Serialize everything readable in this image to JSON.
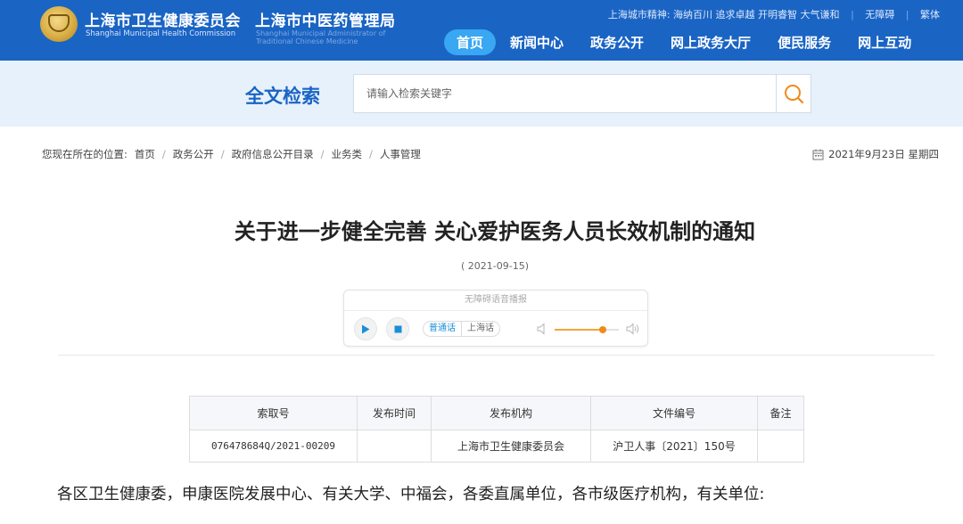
{
  "header": {
    "title_cn": "上海市卫生健康委员会",
    "title_en": "Shanghai Municipal Health Commission",
    "title2_cn": "上海市中医药管理局",
    "title2_en_line1": "Shanghai Municipal Administrator of",
    "title2_en_line2": "Traditional Chinese Medicine",
    "top_links": {
      "slogan": "上海城市精神: 海纳百川 追求卓越 开明睿智 大气谦和",
      "accessible": "无障碍",
      "traditional": "繁体"
    },
    "nav": [
      {
        "label": "首页",
        "active": true
      },
      {
        "label": "新闻中心",
        "active": false
      },
      {
        "label": "政务公开",
        "active": false
      },
      {
        "label": "网上政务大厅",
        "active": false
      },
      {
        "label": "便民服务",
        "active": false
      },
      {
        "label": "网上互动",
        "active": false
      }
    ],
    "bg_color": "#1a64c4",
    "active_nav_color": "#39a7f2"
  },
  "search": {
    "title": "全文检索",
    "placeholder": "请输入检索关键字",
    "button_icon": "search-icon",
    "icon_color": "#f08a1c"
  },
  "breadcrumb": {
    "prefix": "您现在所在的位置:",
    "items": [
      "首页",
      "政务公开",
      "政府信息公开目录",
      "业务类",
      "人事管理"
    ]
  },
  "date": {
    "text": "2021年9月23日 星期四",
    "icon": "calendar-icon"
  },
  "article": {
    "title": "关于进一步健全完善 关心爱护医务人员长效机制的通知",
    "date": "( 2021-09-15)",
    "first_paragraph": "各区卫生健康委，申康医院发展中心、有关大学、中福会，各委直属单位，各市级医疗机构，有关单位:"
  },
  "player": {
    "title": "无障碍语音播报",
    "languages": [
      "普通话",
      "上海话"
    ],
    "active_language": "普通话",
    "volume": 0.75
  },
  "meta_table": {
    "headers": [
      "索取号",
      "发布时间",
      "发布机构",
      "文件编号",
      "备注"
    ],
    "row": [
      "076478684Q/2021-00209",
      "",
      "上海市卫生健康委员会",
      "沪卫人事〔2021〕150号",
      ""
    ]
  }
}
